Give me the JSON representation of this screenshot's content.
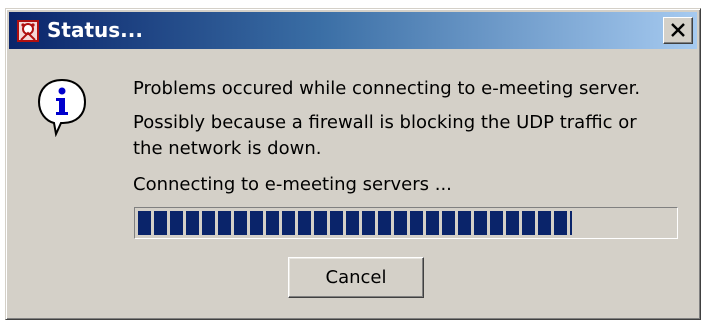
{
  "window": {
    "title": "Status...",
    "title_icon": "connection-status-icon",
    "close_icon": "close-icon"
  },
  "message": {
    "icon": "info-icon",
    "line1": "Problems occured while connecting to e-meeting server.",
    "line2": "Possibly because a firewall is blocking the UDP traffic or",
    "line3": "the network is down.",
    "status": "Connecting to e-meeting servers ..."
  },
  "progress": {
    "fraction": 0.81
  },
  "buttons": {
    "cancel_label": "Cancel"
  },
  "colors": {
    "titlebar_start": "#0a246a",
    "titlebar_end": "#a6caf0",
    "dialog_face": "#d4d0c8",
    "progress_fill": "#0a246a",
    "info_blue": "#0000cc"
  }
}
